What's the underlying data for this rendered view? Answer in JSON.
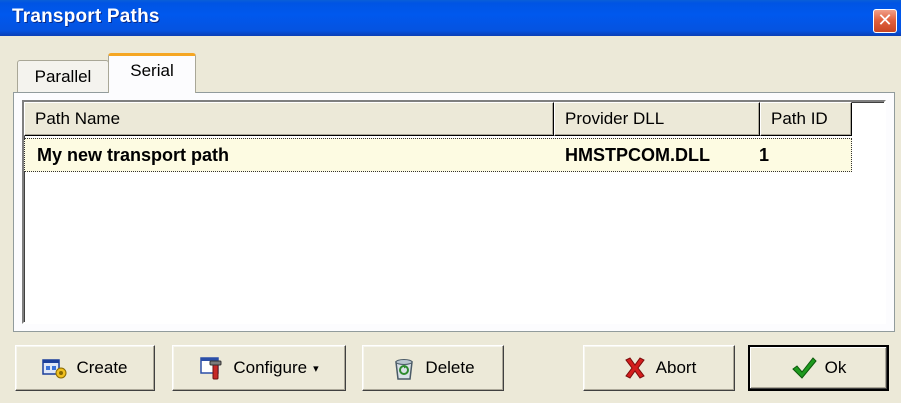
{
  "window": {
    "title": "Transport Paths",
    "close_glyph": "✕"
  },
  "tabs": [
    {
      "label": "Parallel",
      "active": false
    },
    {
      "label": "Serial",
      "active": true
    }
  ],
  "list": {
    "columns": [
      "Path Name",
      "Provider DLL",
      "Path ID"
    ],
    "rows": [
      {
        "path_name": "My new transport path",
        "provider_dll": "HMSTPCOM.DLL",
        "path_id": "1"
      }
    ]
  },
  "buttons": {
    "create": {
      "label": "Create",
      "icon": "create-icon"
    },
    "configure": {
      "label": "Configure",
      "icon": "configure-icon",
      "dropdown": "▾"
    },
    "delete": {
      "label": "Delete",
      "icon": "recycle-bin-icon"
    },
    "abort": {
      "label": "Abort",
      "icon": "red-x-icon"
    },
    "ok": {
      "label": "Ok",
      "icon": "green-check-icon"
    }
  },
  "colors": {
    "titlebar": "#0054e3",
    "selected_row": "#fdfbe2",
    "active_tab_accent": "#f5a623"
  }
}
